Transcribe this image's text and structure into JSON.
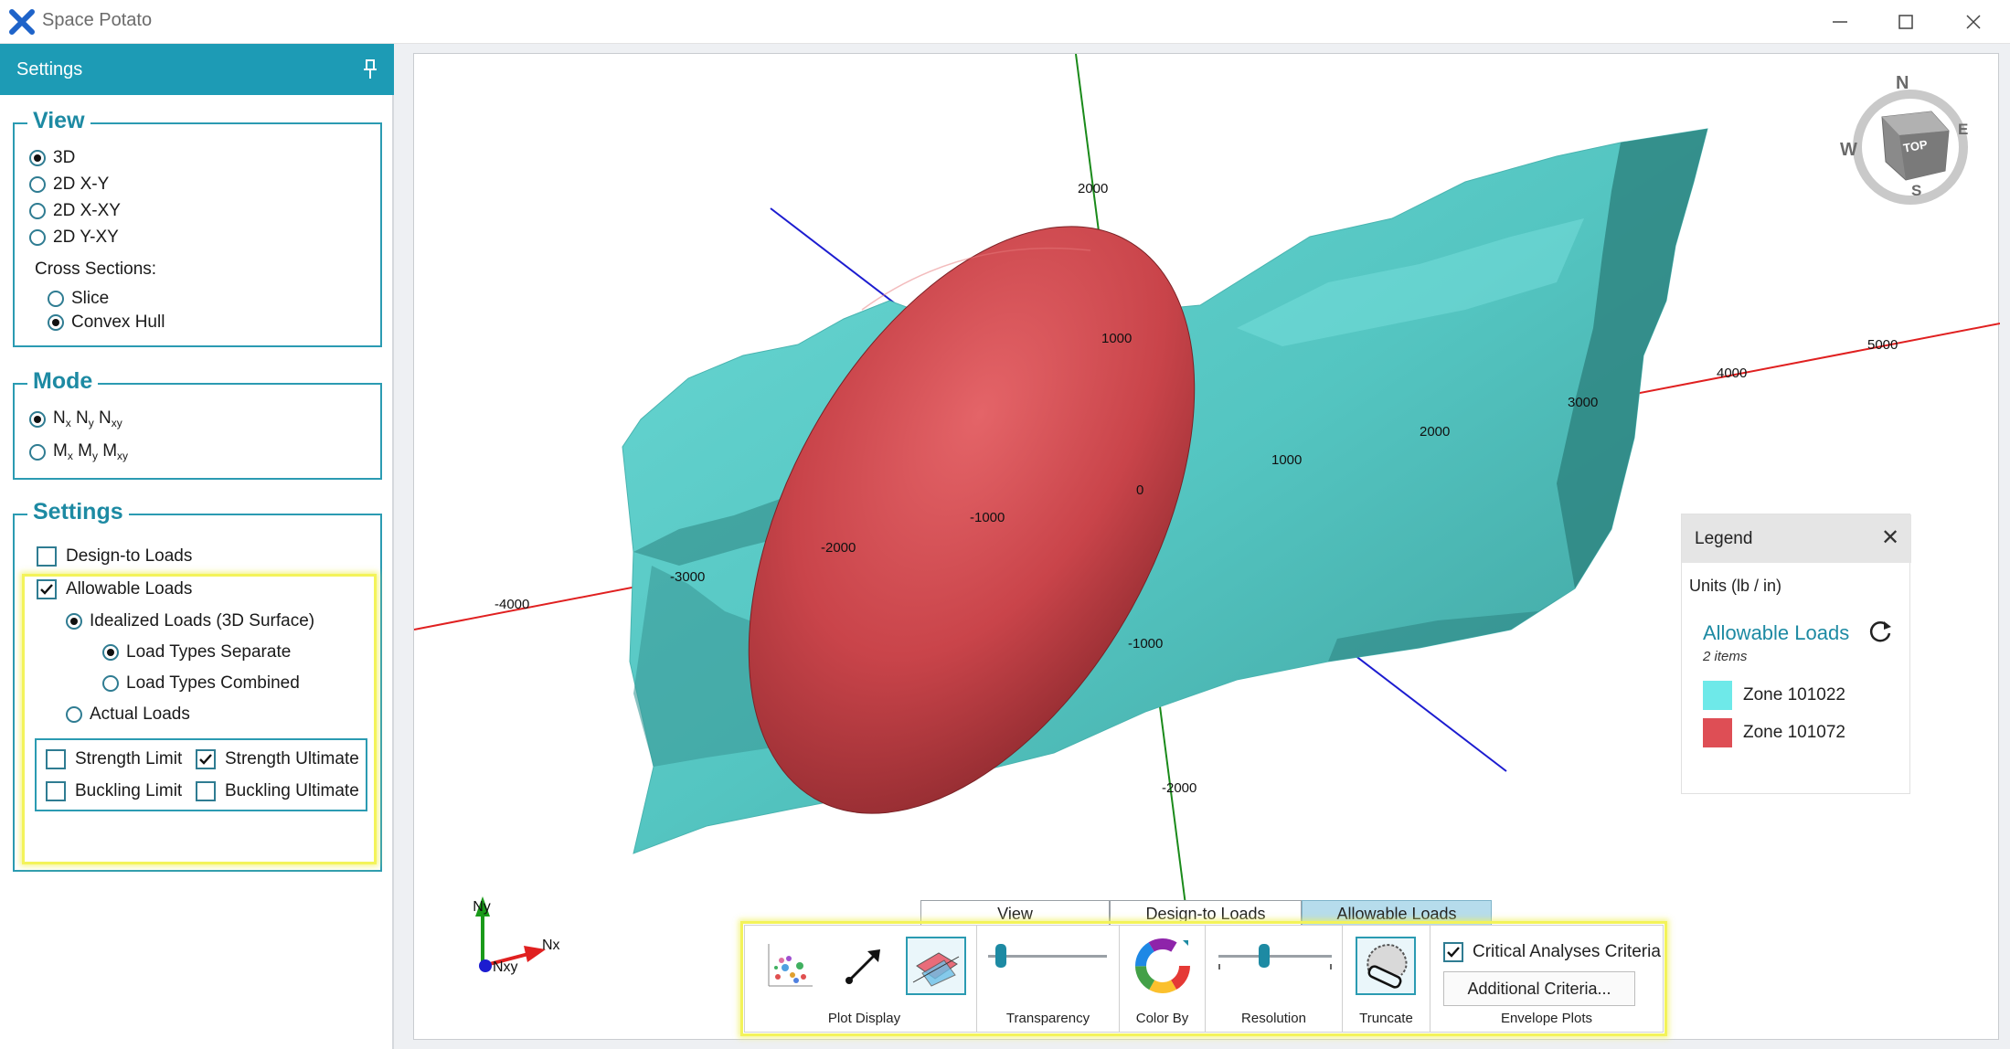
{
  "window": {
    "title": "Space Potato"
  },
  "settings_panel": {
    "header": "Settings",
    "view": {
      "title": "View",
      "options": [
        "3D",
        "2D X-Y",
        "2D X-XY",
        "2D Y-XY"
      ],
      "selected": "3D",
      "cross_sections_label": "Cross Sections:",
      "cross_sections": [
        "Slice",
        "Convex Hull"
      ],
      "cross_selected": "Convex Hull"
    },
    "mode": {
      "title": "Mode",
      "options": [
        {
          "main": [
            "N",
            "N",
            "N"
          ],
          "subs": [
            "x",
            "y",
            "xy"
          ]
        },
        {
          "main": [
            "M",
            "M",
            "M"
          ],
          "subs": [
            "x",
            "y",
            "xy"
          ]
        }
      ],
      "selected_index": 0
    },
    "settings": {
      "title": "Settings",
      "design_to_loads": {
        "label": "Design-to Loads",
        "checked": false
      },
      "allowable_loads": {
        "label": "Allowable Loads",
        "checked": true
      },
      "idealized_loads": {
        "label": "Idealized Loads (3D Surface)",
        "selected": true
      },
      "load_types_separate": {
        "label": "Load Types Separate",
        "selected": true
      },
      "load_types_combined": {
        "label": "Load Types Combined",
        "selected": false
      },
      "actual_loads": {
        "label": "Actual Loads",
        "selected": false
      },
      "strength_limit": {
        "label": "Strength Limit",
        "checked": false
      },
      "strength_ultimate": {
        "label": "Strength Ultimate",
        "checked": true
      },
      "buckling_limit": {
        "label": "Buckling Limit",
        "checked": false
      },
      "buckling_ultimate": {
        "label": "Buckling Ultimate",
        "checked": false
      }
    }
  },
  "viewport": {
    "axis_labels": {
      "x": [
        "-4000",
        "-3000",
        "-2000",
        "-1000",
        "0",
        "1000",
        "2000",
        "3000",
        "4000",
        "5000"
      ],
      "y": [
        "2000",
        "1000",
        "1000",
        "-1000",
        "-2000"
      ]
    },
    "triad": {
      "ny": "Ny",
      "nx": "Nx",
      "nxy": "Nxy"
    },
    "nav_cube": {
      "n": "N",
      "e": "E",
      "s": "S",
      "w": "W",
      "top": "TOP"
    },
    "colors": {
      "hull": "#5ccfcb",
      "ellipsoid": "#d24a4f",
      "x_axis": "#e02020",
      "y_axis": "#1a8a1a",
      "z_axis": "#1c1cd0"
    }
  },
  "legend": {
    "title": "Legend",
    "units": "Units (lb / in)",
    "group": "Allowable Loads",
    "count": "2 items",
    "items": [
      {
        "label": "Zone 101022",
        "color": "#6ee9e9"
      },
      {
        "label": "Zone 101072",
        "color": "#de4e55"
      }
    ]
  },
  "bottom": {
    "tabs": [
      "View",
      "Design-to Loads",
      "Allowable Loads"
    ],
    "active_tab": "Allowable Loads",
    "sections": {
      "plot_display": "Plot Display",
      "transparency": "Transparency",
      "color_by": "Color By",
      "resolution": "Resolution",
      "truncate": "Truncate",
      "envelope_plots": "Envelope Plots"
    },
    "critical_criteria": {
      "label": "Critical Analyses Criteria",
      "checked": true
    },
    "additional_criteria": "Additional Criteria..."
  }
}
